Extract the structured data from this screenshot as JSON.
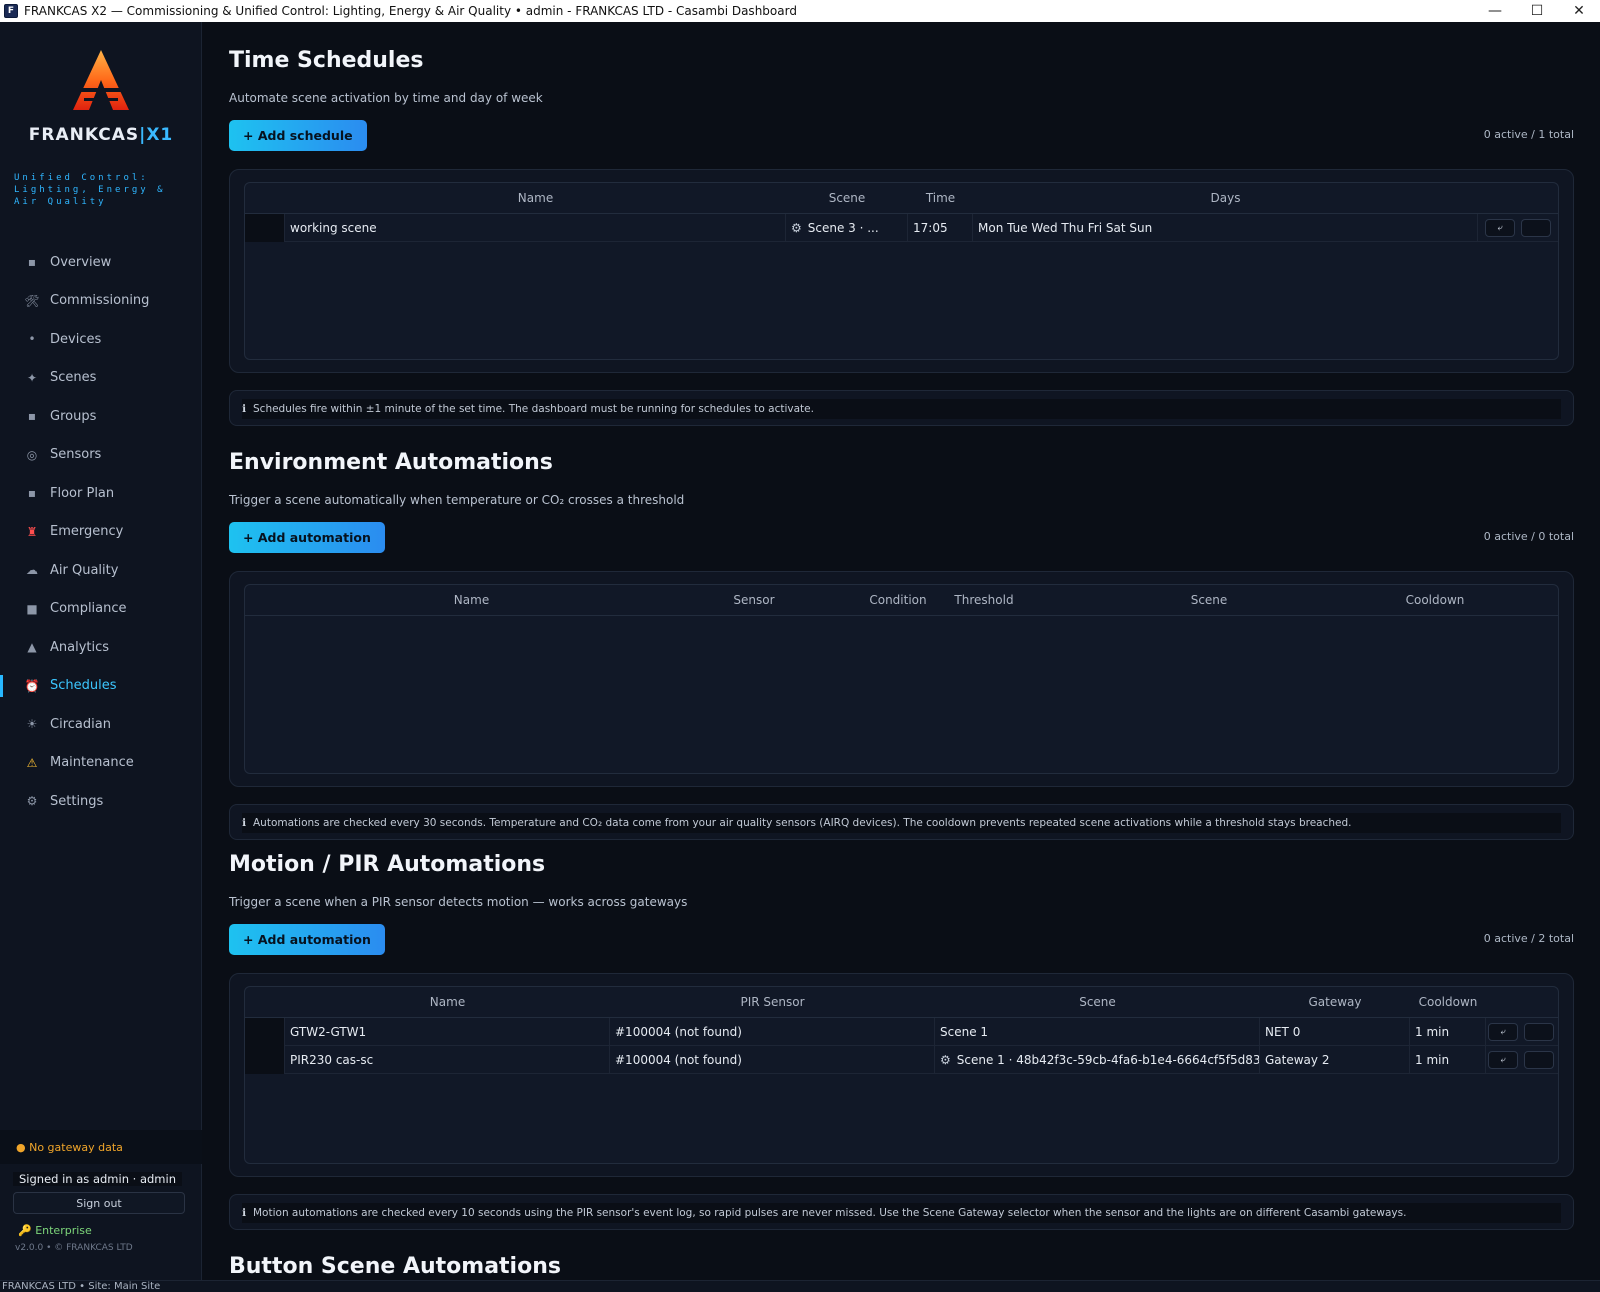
{
  "window": {
    "title": "FRANKCAS X2 — Commissioning & Unified Control: Lighting, Energy & Air Quality  •  admin - FRANKCAS LTD - Casambi Dashboard",
    "minimize": "—",
    "maximize": "☐",
    "close": "✕"
  },
  "brand": {
    "name": "FRANKCAS",
    "suffix": "X1",
    "tagline": "Unified Control: Lighting, Energy & Air Quality"
  },
  "nav": [
    {
      "label": "Overview",
      "icon": "▪"
    },
    {
      "label": "Commissioning",
      "icon": "🛠"
    },
    {
      "label": "Devices",
      "icon": "•"
    },
    {
      "label": "Scenes",
      "icon": "✦"
    },
    {
      "label": "Groups",
      "icon": "▪"
    },
    {
      "label": "Sensors",
      "icon": "◎"
    },
    {
      "label": "Floor Plan",
      "icon": "▪"
    },
    {
      "label": "Emergency",
      "icon": "♜"
    },
    {
      "label": "Air Quality",
      "icon": "☁"
    },
    {
      "label": "Compliance",
      "icon": "■"
    },
    {
      "label": "Analytics",
      "icon": "▲"
    },
    {
      "label": "Schedules",
      "icon": "⏰"
    },
    {
      "label": "Circadian",
      "icon": "☀"
    },
    {
      "label": "Maintenance",
      "icon": "⚠"
    },
    {
      "label": "Settings",
      "icon": "⚙"
    }
  ],
  "active_nav": "Schedules",
  "sidebar_footer": {
    "gateway_status": "● No gateway data",
    "signed_in": "Signed in as  admin · admin",
    "sign_out": "Sign out",
    "license": "🔑  Enterprise",
    "version": "v2.0.0  •  © FRANKCAS LTD"
  },
  "time_schedules": {
    "title": "Time Schedules",
    "subtitle": "Automate scene activation by time and day of week",
    "add_label": "+ Add schedule",
    "count": "0 active / 1 total",
    "columns": [
      "Name",
      "Scene",
      "Time",
      "Days"
    ],
    "rows": [
      {
        "name": "working scene",
        "scene": "Scene 3 · ...",
        "time": "17:05",
        "days": "Mon Tue Wed Thu Fri Sat Sun"
      }
    ],
    "info": "Schedules fire within ±1 minute of the set time. The dashboard must be running for schedules to activate."
  },
  "env_automations": {
    "title": "Environment Automations",
    "subtitle": "Trigger a scene automatically when temperature or CO₂ crosses a threshold",
    "add_label": "+ Add automation",
    "count": "0 active / 0 total",
    "columns": [
      "Name",
      "Sensor",
      "Condition",
      "Threshold",
      "Scene",
      "Cooldown"
    ],
    "info": "Automations are checked every 30 seconds. Temperature and CO₂ data come from your air quality sensors (AIRQ devices). The cooldown prevents repeated scene activations while a threshold stays breached."
  },
  "motion_automations": {
    "title": "Motion / PIR Automations",
    "subtitle": "Trigger a scene when a PIR sensor detects motion  — works across gateways",
    "add_label": "+ Add automation",
    "count": "0 active / 2 total",
    "columns": [
      "Name",
      "PIR Sensor",
      "Scene",
      "Gateway",
      "Cooldown"
    ],
    "rows": [
      {
        "name": "GTW2-GTW1",
        "sensor": "#100004 (not found)",
        "scene": "Scene 1",
        "gateway": "NET 0",
        "cooldown": "1 min"
      },
      {
        "name": "PIR230 cas-sc",
        "sensor": "#100004 (not found)",
        "scene": "Scene 1 · 48b42f3c-59cb-4fa6-b1e4-6664cf5f5d83",
        "gateway": "Gateway 2",
        "cooldown": "1 min"
      }
    ],
    "info": "Motion automations are checked every 10 seconds using the PIR sensor's event log, so rapid pulses are never missed.  Use the Scene Gateway selector when the sensor and the lights are on different Casambi gateways."
  },
  "button_automations": {
    "title": "Button Scene Automations"
  },
  "statusbar": "FRANKCAS LTD  •  Site: Main Site",
  "colors": {
    "accent": "#28b8ff",
    "background": "#0a0e16",
    "warning": "#f0a52a"
  }
}
